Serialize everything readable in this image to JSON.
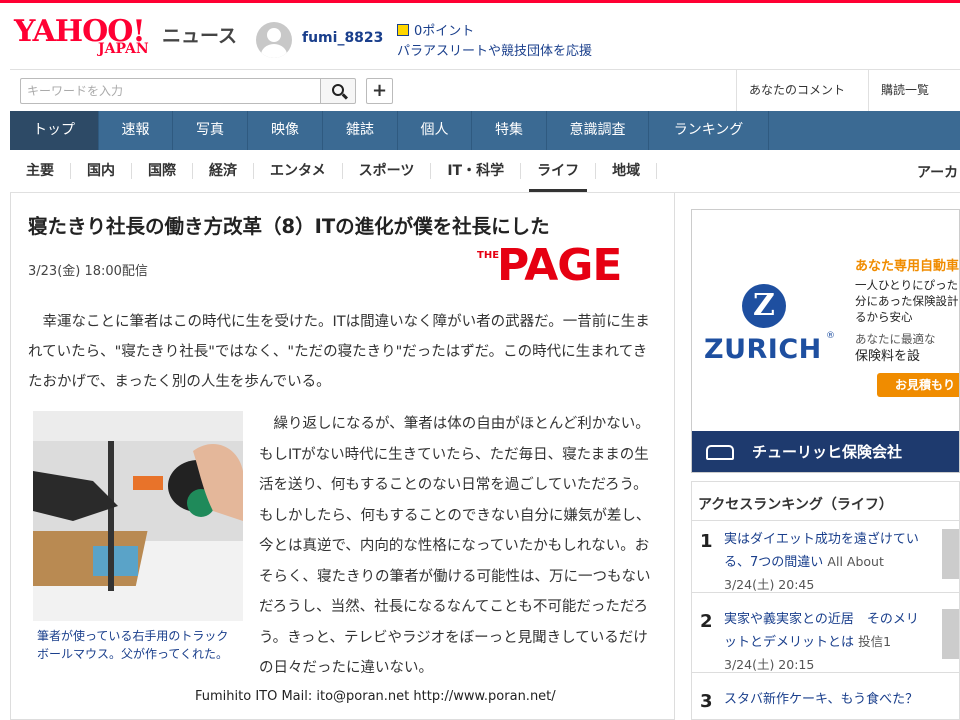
{
  "header": {
    "logo_yahoo": "YAHOO!",
    "logo_japan": "JAPAN",
    "logo_news": "ニュース",
    "username": "fumi_8823",
    "points": "0ポイント",
    "support_link": "パラアスリートや競技団体を応援"
  },
  "search": {
    "placeholder": "キーワードを入力",
    "add_label": "+",
    "right_links": [
      "あなたのコメント",
      "購読一覧"
    ]
  },
  "main_nav": [
    "トップ",
    "速報",
    "写真",
    "映像",
    "雑誌",
    "個人",
    "特集",
    "意識調査",
    "ランキング"
  ],
  "sub_nav": [
    "主要",
    "国内",
    "国際",
    "経済",
    "エンタメ",
    "スポーツ",
    "IT・科学",
    "ライフ",
    "地域"
  ],
  "sub_nav_more": "アーカ",
  "article": {
    "headline": "寝たきり社長の働き方改革（8）ITの進化が僕を社長にした",
    "date": "3/23(金) 18:00配信",
    "source_small": "THE",
    "source": "PAGE",
    "para1": "幸運なことに筆者はこの時代に生を受けた。ITは間違いなく障がい者の武器だ。一昔前に生まれていたら、\"寝たきり社長\"ではなく、\"ただの寝たきり\"だったはずだ。この時代に生まれてきたおかげで、まったく別の人生を歩んでいる。",
    "caption": "筆者が使っている右手用のトラックボールマウス。父が作ってくれた。",
    "para2": "繰り返しになるが、筆者は体の自由がほとんど利かない。もしITがない時代に生きていたら、ただ毎日、寝たままの生活を送り、何もすることのない日常を過ごしていただろう。もしかしたら、何もすることのできない自分に嫌気が差し、今とは真逆で、内向的な性格になっていたかもしれない。おそらく、寝たきりの筆者が働ける可能性は、万に一つもないだろうし、当然、社長になるなんてことも不可能だっただろう。きっと、テレビやラジオをぼーっと見聞きしているだけの日々だったに違いない。"
  },
  "watermark": "Fumihito ITO Mail: ito@poran.net http://www.poran.net/",
  "ad": {
    "logo_letter": "Z",
    "brand": "ZURICH",
    "reg": "®",
    "title": "あなた専用自動車",
    "lines": [
      "一人ひとりにぴったり",
      "分にあった保険設計",
      "るから安心",
      "あなたに最適な",
      "保険料を設"
    ],
    "button": "お見積もり",
    "bar": "チューリッヒ保険会社"
  },
  "ranking": {
    "title": "アクセスランキング（ライフ）",
    "items": [
      {
        "rank": "1",
        "title": "実はダイエット成功を遠ざけている、7つの間違い",
        "meta": "All About 3/24(土) 20:45"
      },
      {
        "rank": "2",
        "title": "実家や義実家との近居　そのメリットとデメリットとは",
        "meta": "投信1 3/24(土) 20:15"
      },
      {
        "rank": "3",
        "title": "スタバ新作ケーキ、もう食べた？",
        "meta": ""
      }
    ]
  }
}
